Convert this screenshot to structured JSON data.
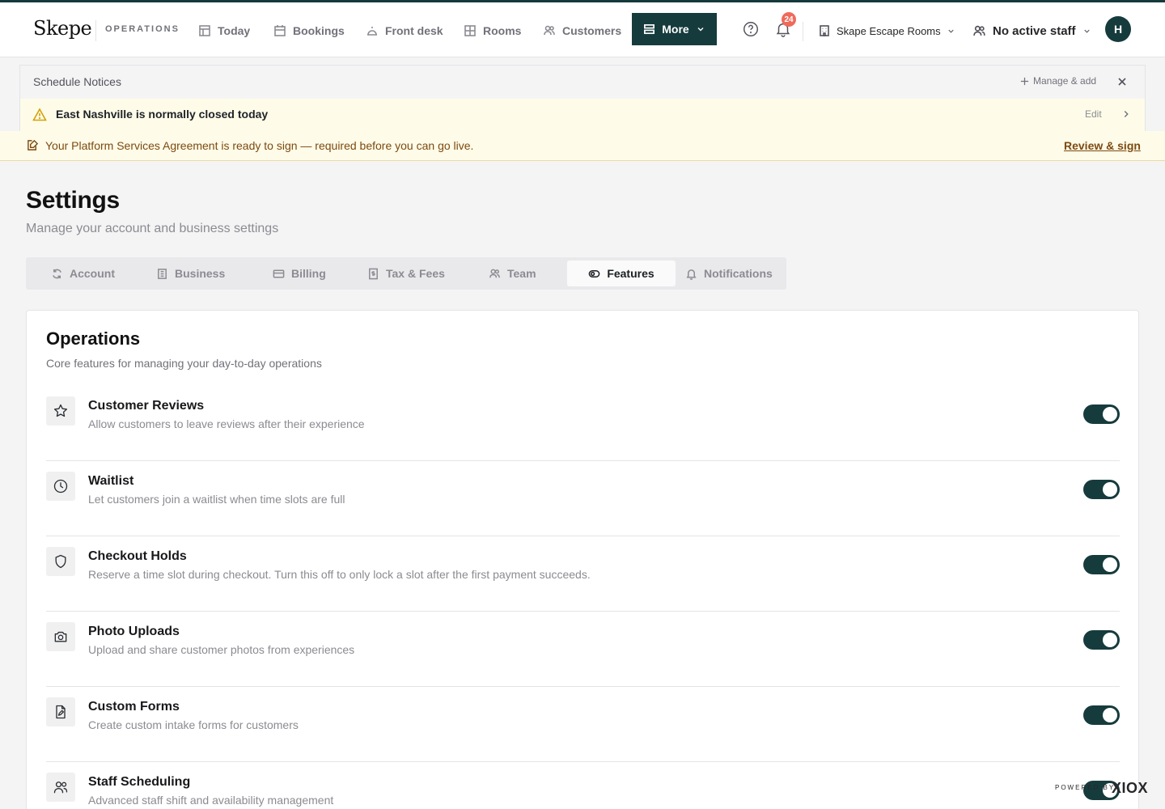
{
  "header": {
    "logo": "Skepe",
    "section_label": "OPERATIONS",
    "nav": [
      {
        "label": "Today",
        "icon": "calendar-grid-icon"
      },
      {
        "label": "Bookings",
        "icon": "calendar-icon"
      },
      {
        "label": "Front desk",
        "icon": "bell-desk-icon"
      },
      {
        "label": "Rooms",
        "icon": "rooms-grid-icon"
      },
      {
        "label": "Customers",
        "icon": "users-icon"
      }
    ],
    "more_label": "More",
    "notification_count": "24",
    "org_name": "Skape Escape Rooms",
    "staff_label": "No active staff",
    "avatar_initial": "H"
  },
  "notices": {
    "title": "Schedule Notices",
    "manage_label": "Manage & add",
    "items": [
      {
        "text": "East Nashville is normally closed today",
        "edit_label": "Edit"
      }
    ]
  },
  "agreement_banner": {
    "text": "Your Platform Services Agreement is ready to sign — required before you can go live.",
    "link_label": "Review & sign"
  },
  "page": {
    "title": "Settings",
    "subtitle": "Manage your account and business settings"
  },
  "tabs": [
    {
      "label": "Account",
      "icon": "refresh-icon",
      "active": false
    },
    {
      "label": "Business",
      "icon": "building-icon",
      "active": false
    },
    {
      "label": "Billing",
      "icon": "credit-card-icon",
      "active": false
    },
    {
      "label": "Tax & Fees",
      "icon": "receipt-icon",
      "active": false
    },
    {
      "label": "Team",
      "icon": "team-icon",
      "active": false
    },
    {
      "label": "Features",
      "icon": "eye-toggle-icon",
      "active": true
    },
    {
      "label": "Notifications",
      "icon": "bell-icon",
      "active": false
    }
  ],
  "operations": {
    "title": "Operations",
    "subtitle": "Core features for managing your day-to-day operations",
    "features": [
      {
        "name": "Customer Reviews",
        "description": "Allow customers to leave reviews after their experience",
        "icon": "star-icon",
        "enabled": true
      },
      {
        "name": "Waitlist",
        "description": "Let customers join a waitlist when time slots are full",
        "icon": "clock-icon",
        "enabled": true
      },
      {
        "name": "Checkout Holds",
        "description": "Reserve a time slot during checkout. Turn this off to only lock a slot after the first payment succeeds.",
        "icon": "shield-icon",
        "enabled": true
      },
      {
        "name": "Photo Uploads",
        "description": "Upload and share customer photos from experiences",
        "icon": "camera-icon",
        "enabled": true
      },
      {
        "name": "Custom Forms",
        "description": "Create custom intake forms for customers",
        "icon": "form-edit-icon",
        "enabled": true
      },
      {
        "name": "Staff Scheduling",
        "description": "Advanced staff shift and availability management",
        "icon": "users-icon",
        "enabled": true
      }
    ]
  },
  "footer": {
    "powered_by": "POWERED BY",
    "brand": "XIOX"
  },
  "colors": {
    "brand_dark": "#163b3d",
    "notice_bg": "#fefce8",
    "badge": "#ef6a5b",
    "agreement_text": "#7c4a10"
  }
}
